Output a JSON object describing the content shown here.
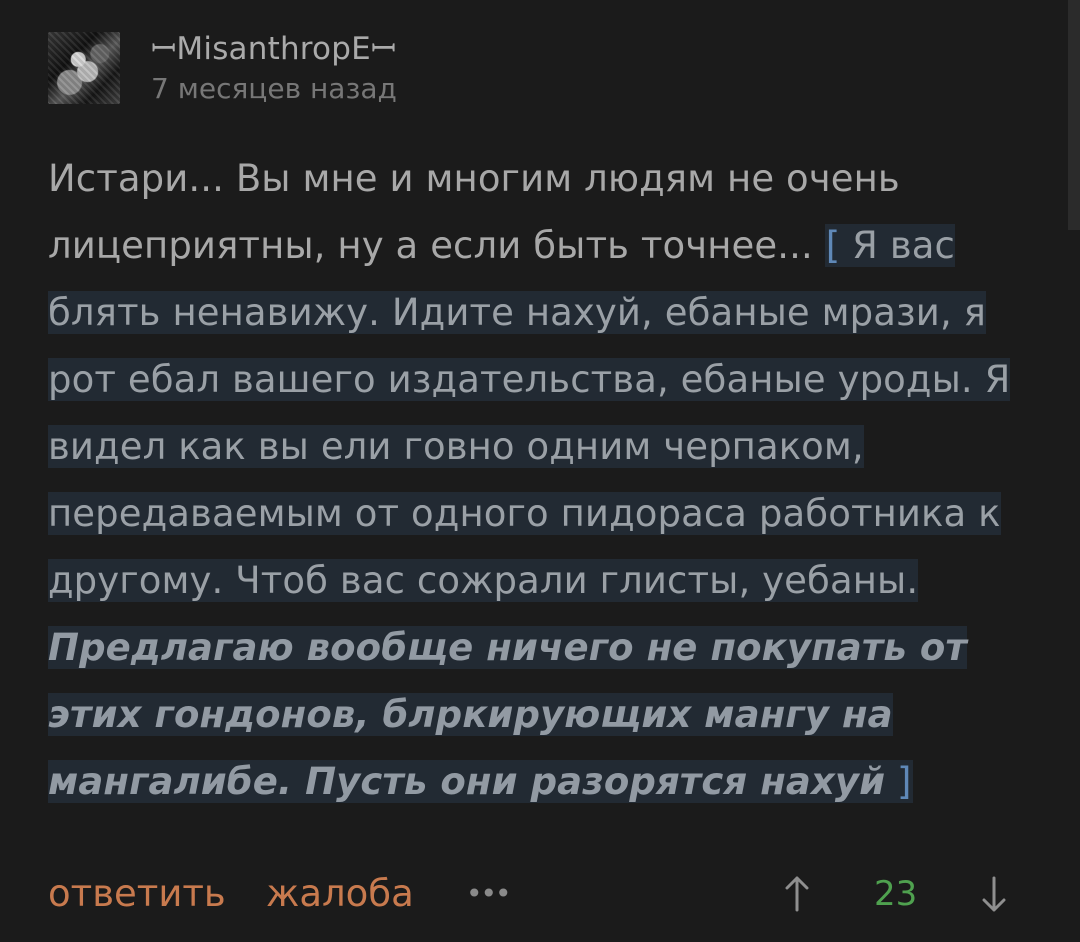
{
  "comment": {
    "username": "ꟷMisanthropEꟷ",
    "time": "7 месяцев назад",
    "text_plain": "Истари... Вы мне и многим людям не очень лицеприятны, ну а если быть точнее...",
    "spoiler_open": "[",
    "spoiler_text": "Я вас блять ненавижу. Идите нахуй, ебаные мрази, я рот ебал вашего издательства, ебаные уроды. Я видел как вы ели говно одним черпаком, передаваемым от одного пидораса работника к другому. Чтоб вас сожрали глисты, уебаны.",
    "spoiler_bold": "Предлагаю вообще ничего не покупать от этих гондонов, блркирующих мангу на мангалибе. Пусть они разорятся нахуй",
    "spoiler_close": "]"
  },
  "actions": {
    "reply": "ответить",
    "report": "жалоба",
    "more": "•••",
    "score": "23"
  },
  "colors": {
    "background": "#1b1b1b",
    "spoiler_background": "#222a33",
    "action_orange": "#c87a4e",
    "score_green": "#4fa14f",
    "bracket_blue": "#5f88b7"
  },
  "icons": {
    "upvote": "arrow-up-icon",
    "downvote": "arrow-down-icon",
    "more": "more-horizontal-icon"
  }
}
